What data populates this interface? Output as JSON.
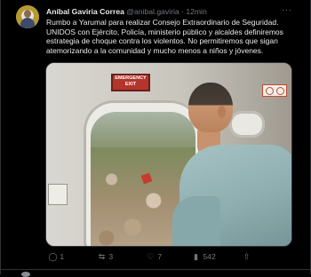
{
  "tweet": {
    "author_name": "Aníbal Gaviria Correa",
    "author_handle": "@anibal.gaviria",
    "separator": "·",
    "time": "12min",
    "more_label": "···",
    "text": "Rumbo a Yarumal para realizar Consejo Extraordinario de Seguridad. UNIDOS con Ejército, Policía, ministerio público y alcaldes definiremos estrategia de choque contra los violentos. No permitiremos que sigan atemorizando a la comunidad y mucho menos a niños y jóvenes.",
    "media": {
      "exit_sign": "EMERGENCY\nEXIT"
    },
    "actions": {
      "replies": "1",
      "retweets": "3",
      "likes": "7",
      "views": "542"
    },
    "icons": {
      "reply": "reply-icon",
      "retweet": "retweet-icon",
      "like": "like-icon",
      "views": "views-icon",
      "share": "share-icon"
    }
  },
  "colors": {
    "background": "#000000",
    "text_primary": "#e7e9ea",
    "text_secondary": "#71767b",
    "border": "#2f3336"
  }
}
